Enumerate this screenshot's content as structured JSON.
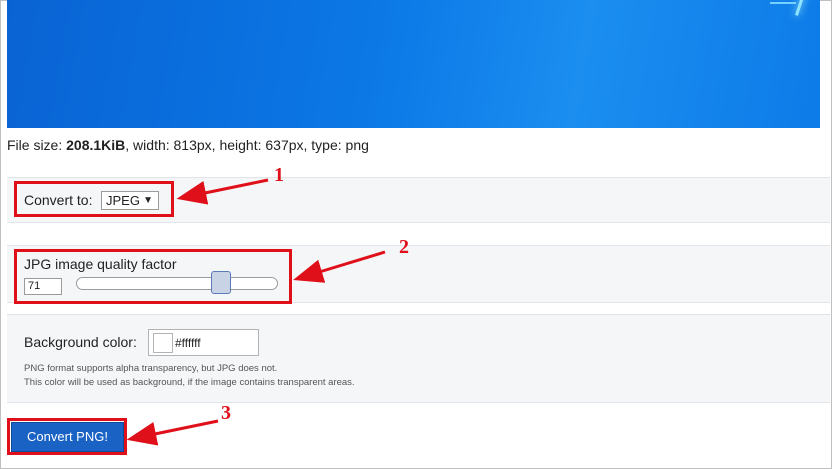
{
  "fileinfo": {
    "prefix": "File size: ",
    "size": "208.1KiB",
    "rest": ", width: 813px, height: 637px, type: png"
  },
  "convert": {
    "label": "Convert to:",
    "selected": "JPEG",
    "caret": "▼"
  },
  "quality": {
    "label": "JPG image quality factor",
    "value": "71",
    "slider_level": 0.71
  },
  "background": {
    "label": "Background color:",
    "value": "#ffffff",
    "swatch_color": "#ffffff",
    "note1": "PNG format supports alpha transparency, but JPG does not.",
    "note2": "This color will be used as background, if the image contains transparent areas."
  },
  "action": {
    "button_label": "Convert PNG!"
  },
  "annotations": {
    "n1": "1",
    "n2": "2",
    "n3": "3",
    "color": "#e0101a"
  }
}
